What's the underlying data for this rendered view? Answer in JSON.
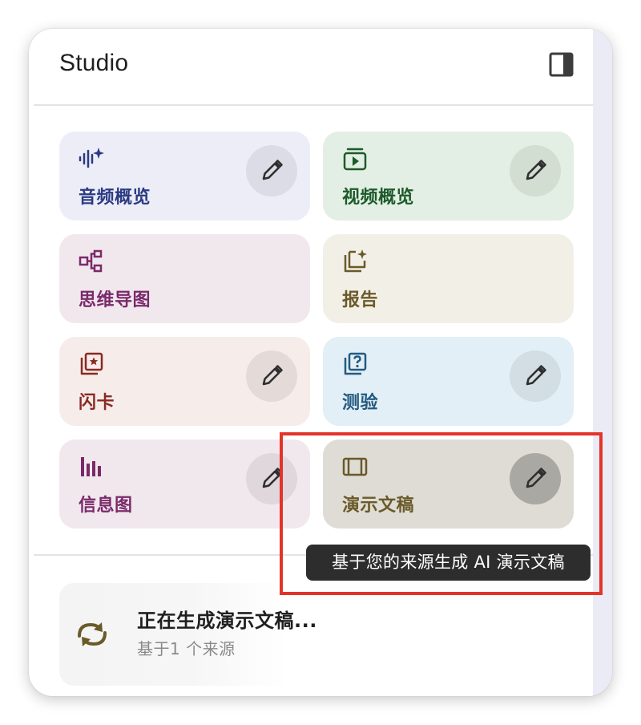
{
  "header": {
    "title": "Studio",
    "panel_toggle_icon": "side-panel-icon"
  },
  "tiles": [
    {
      "label": "音频概览",
      "icon": "audio-sparkle-icon",
      "has_edit": true,
      "bg": "#ededf8",
      "color": "#2b3b82"
    },
    {
      "label": "视频概览",
      "icon": "video-icon",
      "has_edit": true,
      "bg": "#e3efe4",
      "color": "#1d5a2a"
    },
    {
      "label": "思维导图",
      "icon": "mind-map-icon",
      "has_edit": false,
      "bg": "#f1e8ee",
      "color": "#7a2a6a"
    },
    {
      "label": "报告",
      "icon": "report-sparkle-icon",
      "has_edit": false,
      "bg": "#f2f0e6",
      "color": "#6a5a2a"
    },
    {
      "label": "闪卡",
      "icon": "flashcard-icon",
      "has_edit": true,
      "bg": "#f6ecea",
      "color": "#8a2a22"
    },
    {
      "label": "测验",
      "icon": "quiz-icon",
      "has_edit": true,
      "bg": "#e2eff6",
      "color": "#245a80"
    },
    {
      "label": "信息图",
      "icon": "infographic-icon",
      "has_edit": true,
      "bg": "#f1e8ee",
      "color": "#7a2a6a"
    },
    {
      "label": "演示文稿",
      "icon": "slides-icon",
      "has_edit": true,
      "bg": "#dedcd4",
      "color": "#6a5a2a",
      "hovered": true
    }
  ],
  "tooltip": "基于您的来源生成 AI 演示文稿",
  "generating": {
    "icon": "sync-icon",
    "title": "正在生成演示文稿...",
    "subtitle": "基于1 个来源"
  },
  "colors": {
    "highlight": "#e3342a",
    "tooltip_bg": "#2d2d2d"
  }
}
